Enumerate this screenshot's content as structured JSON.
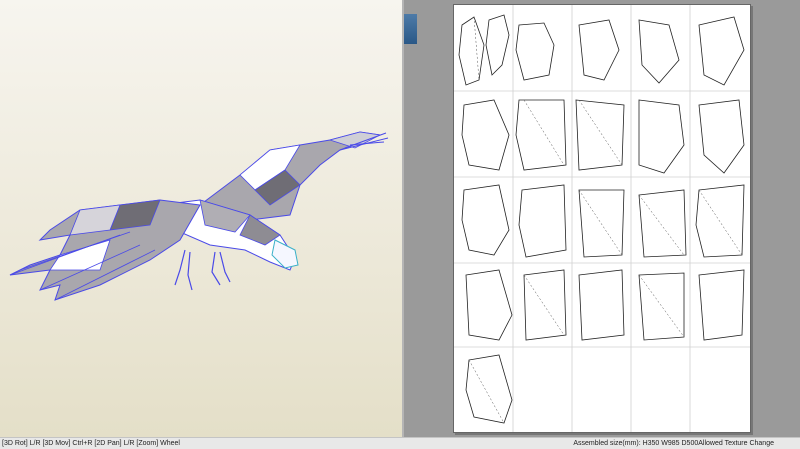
{
  "status_bar": {
    "hint": "[3D Rot] L/R [3D Mov] Ctrl+R [2D Pan] L/R [Zoom] Wheel",
    "info": "Assembled size(mm): H350 W985 D500Allowed Texture Change"
  },
  "viewports": {
    "left": "3D model view (low-poly eagle)",
    "right": "2D unfolded pattern sheet"
  },
  "colors": {
    "background_3d": "#f3f0e4",
    "model_edge": "#4a4ae8",
    "model_fill": "#9c9aa0",
    "sheet": "#ffffff"
  }
}
